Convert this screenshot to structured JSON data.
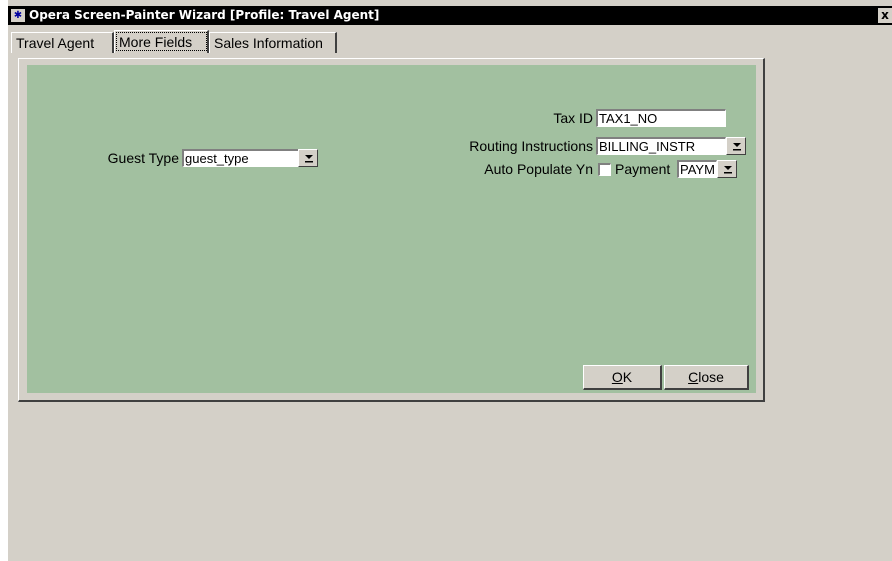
{
  "window": {
    "title": "Opera Screen-Painter Wizard [Profile: Travel Agent]",
    "close_glyph": "x"
  },
  "tabs": [
    {
      "label": "Travel Agent"
    },
    {
      "label": "More Fields",
      "active": true
    },
    {
      "label": "Sales Information"
    }
  ],
  "form": {
    "guest_type": {
      "label": "Guest Type",
      "value": "guest_type"
    },
    "tax_id": {
      "label": "Tax ID",
      "value": "TAX1_NO"
    },
    "routing": {
      "label": "Routing Instructions",
      "value": "BILLING_INSTR"
    },
    "auto_populate": {
      "label": "Auto Populate Yn",
      "checked": false
    },
    "payment": {
      "label": "Payment",
      "value": "PAYM"
    }
  },
  "buttons": {
    "ok": {
      "mnemonic": "O",
      "rest": "K"
    },
    "close": {
      "mnemonic": "C",
      "rest": "lose"
    }
  },
  "colors": {
    "canvas": "#a2c0a0",
    "window": "#d4d0c8",
    "titlebar": "#000000"
  }
}
